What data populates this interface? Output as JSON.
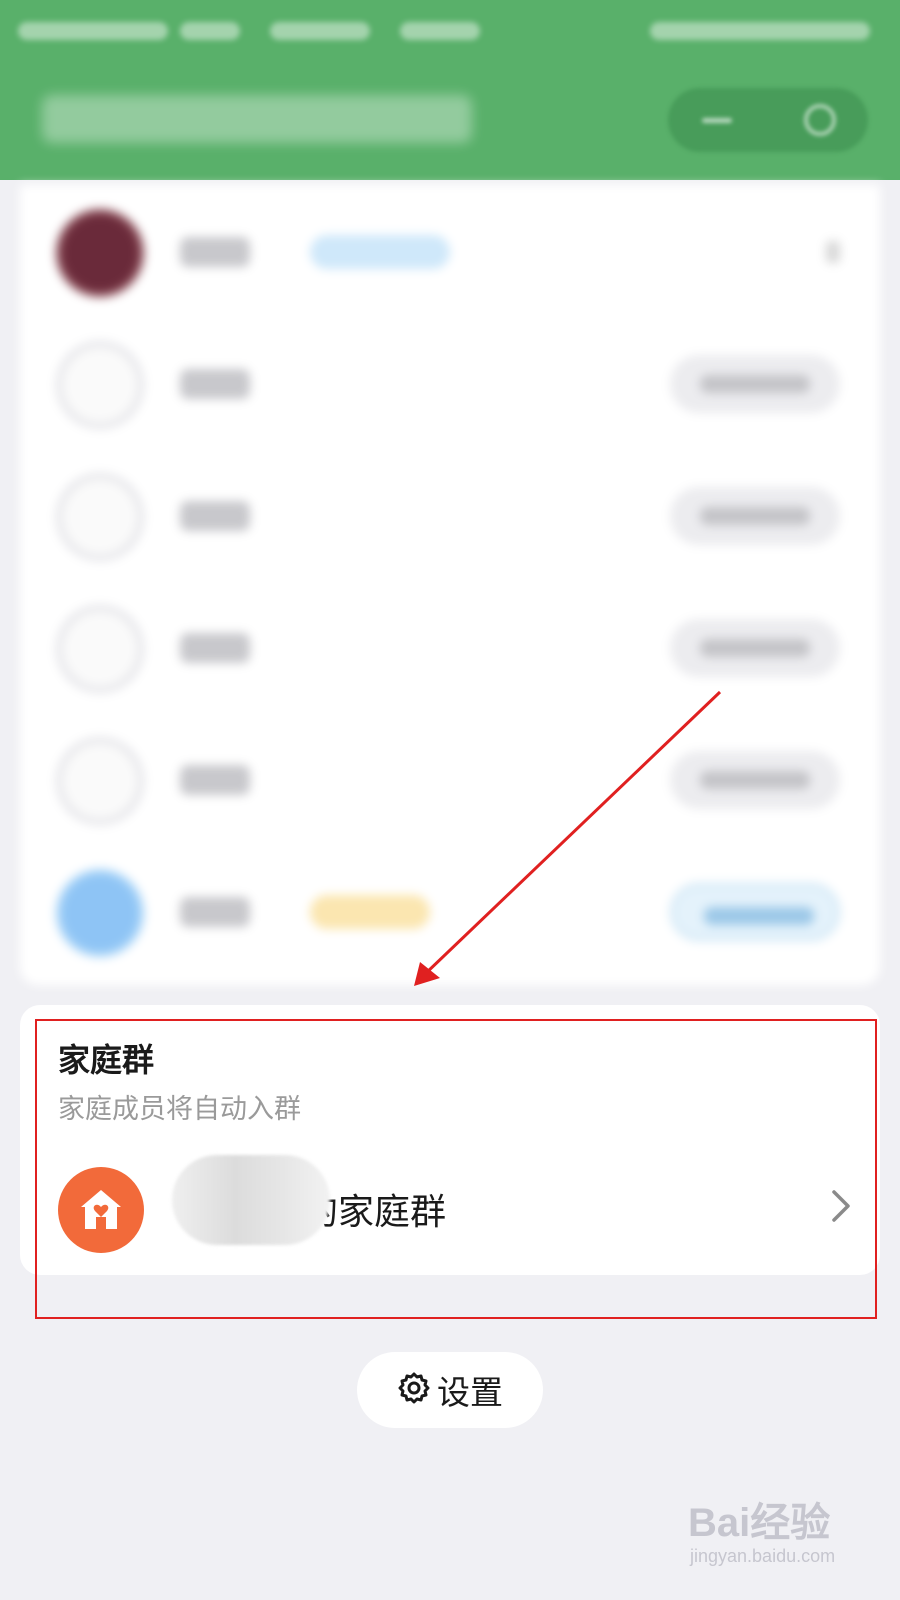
{
  "family_group": {
    "title": "家庭群",
    "subtitle": "家庭成员将自动入群",
    "group_name": "的家庭群"
  },
  "settings": {
    "label": "设置"
  },
  "watermark": {
    "logo": "Bai经验",
    "url": "jingyan.baidu.com"
  },
  "colors": {
    "header_green": "#59b06a",
    "group_icon_orange": "#f26a3a",
    "annotation_red": "#e02020"
  }
}
